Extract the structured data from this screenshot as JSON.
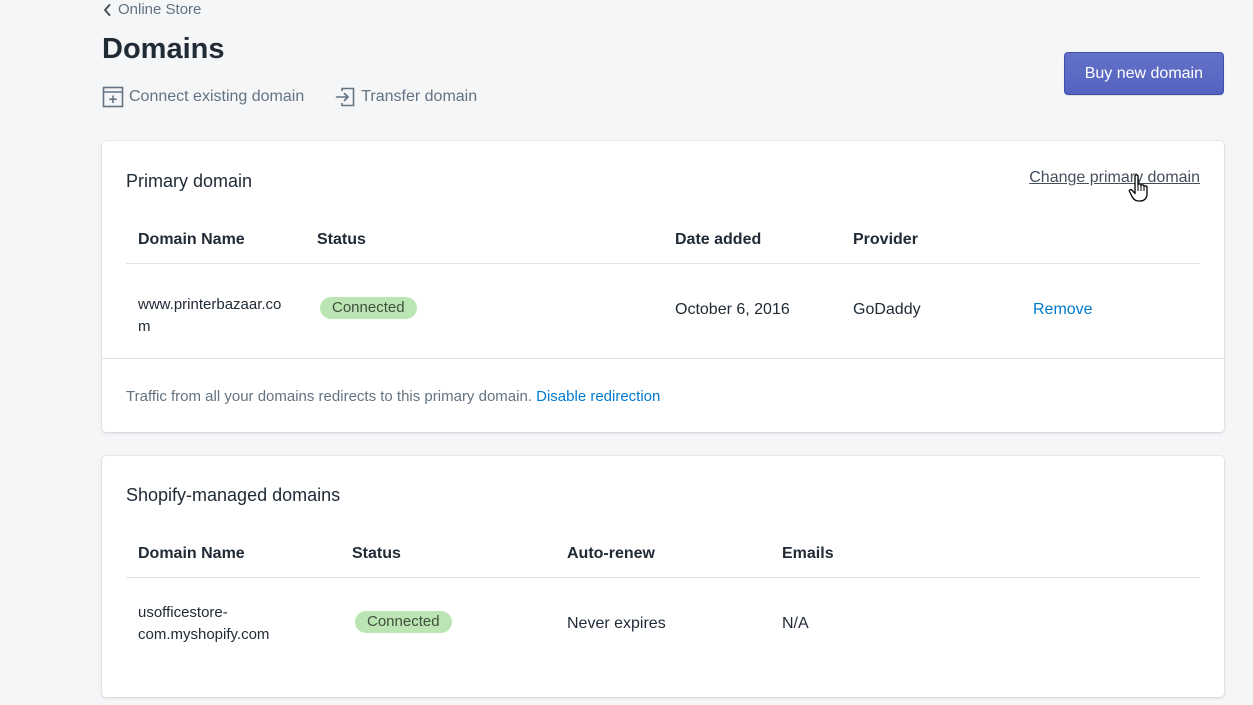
{
  "breadcrumb": {
    "label": "Online Store"
  },
  "page": {
    "title": "Domains"
  },
  "actions": {
    "connect": "Connect existing domain",
    "transfer": "Transfer domain",
    "buy": "Buy new domain"
  },
  "primary": {
    "title": "Primary domain",
    "change_link": "Change primary domain",
    "headers": [
      "Domain Name",
      "Status",
      "Date added",
      "Provider"
    ],
    "row": {
      "domain": "www.printerbazaar.com",
      "status": "Connected",
      "date_added": "October 6, 2016",
      "provider": "GoDaddy",
      "remove": "Remove"
    },
    "footer_text": "Traffic from all your domains redirects to this primary domain.",
    "footer_link": "Disable redirection"
  },
  "managed": {
    "title": "Shopify-managed domains",
    "headers": [
      "Domain Name",
      "Status",
      "Auto-renew",
      "Emails"
    ],
    "row": {
      "domain": "usofficestore-com.myshopify.com",
      "status": "Connected",
      "auto_renew": "Never expires",
      "emails": "N/A"
    }
  },
  "colors": {
    "primary_button": "#5c6ac4",
    "link": "#007ace",
    "badge_success": "#bbe5b3",
    "background": "#f4f6f8"
  }
}
